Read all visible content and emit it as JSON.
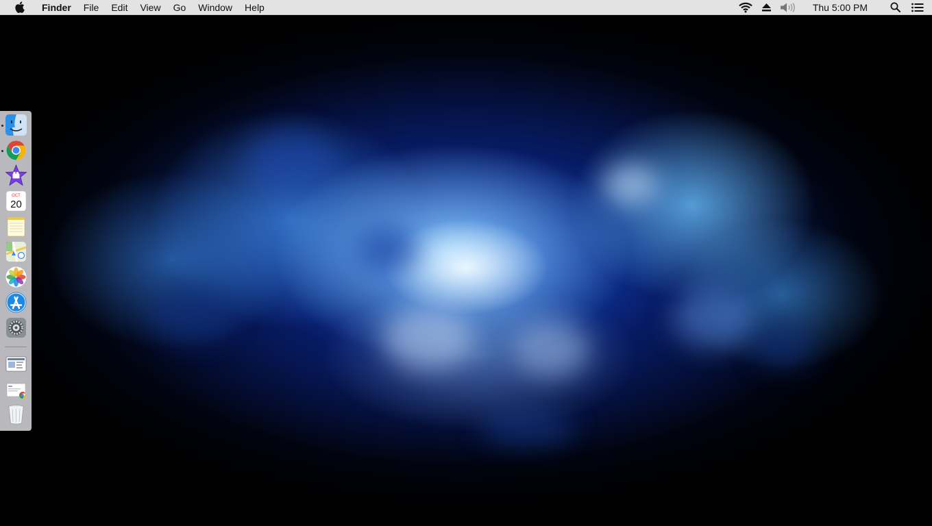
{
  "menubar": {
    "apple_icon": "apple-logo-icon",
    "app_name": "Finder",
    "menus": [
      "File",
      "Edit",
      "View",
      "Go",
      "Window",
      "Help"
    ],
    "status_icons": [
      "wifi-icon",
      "eject-icon",
      "volume-icon"
    ],
    "clock": "Thu 5:00 PM",
    "right_icons": [
      "spotlight-icon",
      "notification-center-icon"
    ]
  },
  "dock": {
    "position": "left",
    "apps": [
      {
        "name": "Finder",
        "icon": "finder-icon",
        "running": true
      },
      {
        "name": "Google Chrome",
        "icon": "chrome-icon",
        "running": true
      },
      {
        "name": "iMovie",
        "icon": "imovie-icon",
        "running": false
      },
      {
        "name": "Calendar",
        "icon": "calendar-icon",
        "running": false,
        "month": "OCT",
        "day": "20"
      },
      {
        "name": "Notes",
        "icon": "notes-icon",
        "running": false
      },
      {
        "name": "Maps",
        "icon": "maps-icon",
        "running": false
      },
      {
        "name": "Photos",
        "icon": "photos-icon",
        "running": false
      },
      {
        "name": "App Store",
        "icon": "app-store-icon",
        "running": false
      },
      {
        "name": "System Preferences",
        "icon": "system-preferences-icon",
        "running": false
      }
    ],
    "others": [
      {
        "name": "Screenshot",
        "icon": "screenshot-thumbnail-icon"
      },
      {
        "name": "Document",
        "icon": "chrome-document-icon"
      },
      {
        "name": "Trash",
        "icon": "trash-icon"
      }
    ]
  },
  "colors": {
    "menubar_bg": "#e3e3e3",
    "wallpaper_core": "#5fb8ff",
    "wallpaper_edge": "#000000"
  }
}
